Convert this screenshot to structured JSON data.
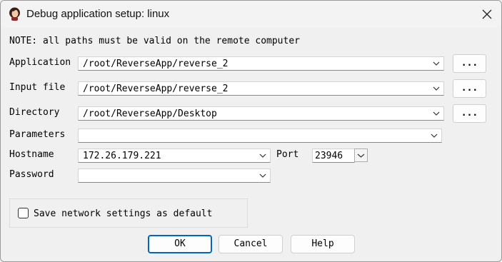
{
  "window": {
    "title": "Debug application setup: linux",
    "app_icon": "avatar-icon",
    "close_icon": "close-icon"
  },
  "note": "NOTE: all paths must be valid on the remote computer",
  "fields": {
    "application": {
      "label": "Application",
      "value": "/root/ReverseApp/reverse_2"
    },
    "input_file": {
      "label": "Input file",
      "value": "/root/ReverseApp/reverse_2"
    },
    "directory": {
      "label": "Directory",
      "value": "/root/ReverseApp/Desktop"
    },
    "parameters": {
      "label": "Parameters",
      "value": ""
    },
    "hostname": {
      "label": "Hostname",
      "value": "172.26.179.221"
    },
    "port": {
      "label": "Port",
      "value": "23946"
    },
    "password": {
      "label": "Password",
      "value": ""
    }
  },
  "browse_label": "...",
  "save_settings": {
    "label": "Save network settings as default",
    "checked": false
  },
  "buttons": {
    "ok": "OK",
    "cancel": "Cancel",
    "help": "Help"
  },
  "colors": {
    "accent": "#0067c0",
    "background": "#f0f0f0"
  }
}
